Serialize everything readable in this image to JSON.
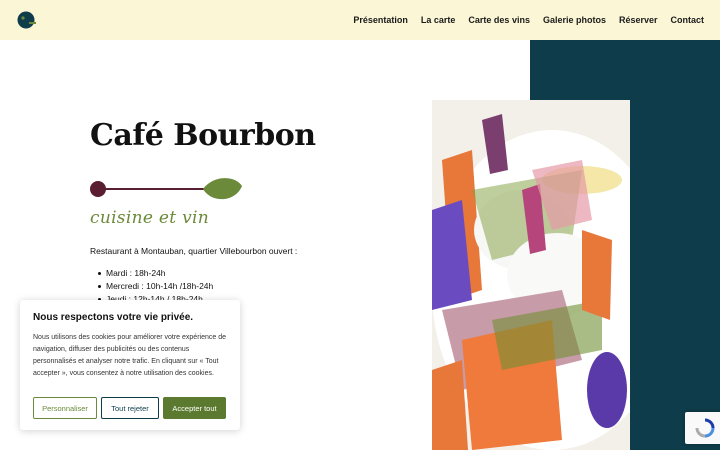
{
  "header": {
    "logo_icon": "cafe-bourbon-logo-icon",
    "nav": [
      "Présentation",
      "La carte",
      "Carte des vins",
      "Galerie photos",
      "Réserver",
      "Contact"
    ]
  },
  "hero": {
    "title": "Café Bourbon",
    "tagline": "cuisine et vin",
    "intro": "Restaurant à Montauban, quartier Villebourbon ouvert :",
    "hours": [
      "Mardi : 18h-24h",
      "Mercredi : 10h-14h /18h-24h",
      "Jeudi : 12h-14h / 18h-24h"
    ],
    "photo_icon": "dish-photo"
  },
  "cookie_banner": {
    "title": "Nous respectons votre vie privée.",
    "text": "Nous utilisons des cookies pour améliorer votre expérience de navigation, diffuser des publicités ou des contenus personnalisés et analyser notre trafic. En cliquant sur « Tout accepter », vous consentez à notre utilisation des cookies.",
    "customize_label": "Personnaliser",
    "reject_label": "Tout rejeter",
    "accept_label": "Accepter tout"
  },
  "colors": {
    "header_bg": "#fbf6d6",
    "teal": "#0e3c4a",
    "olive": "#6b8a3a",
    "accept_bg": "#5b7a2f"
  },
  "recaptcha_icon": "recaptcha-icon"
}
